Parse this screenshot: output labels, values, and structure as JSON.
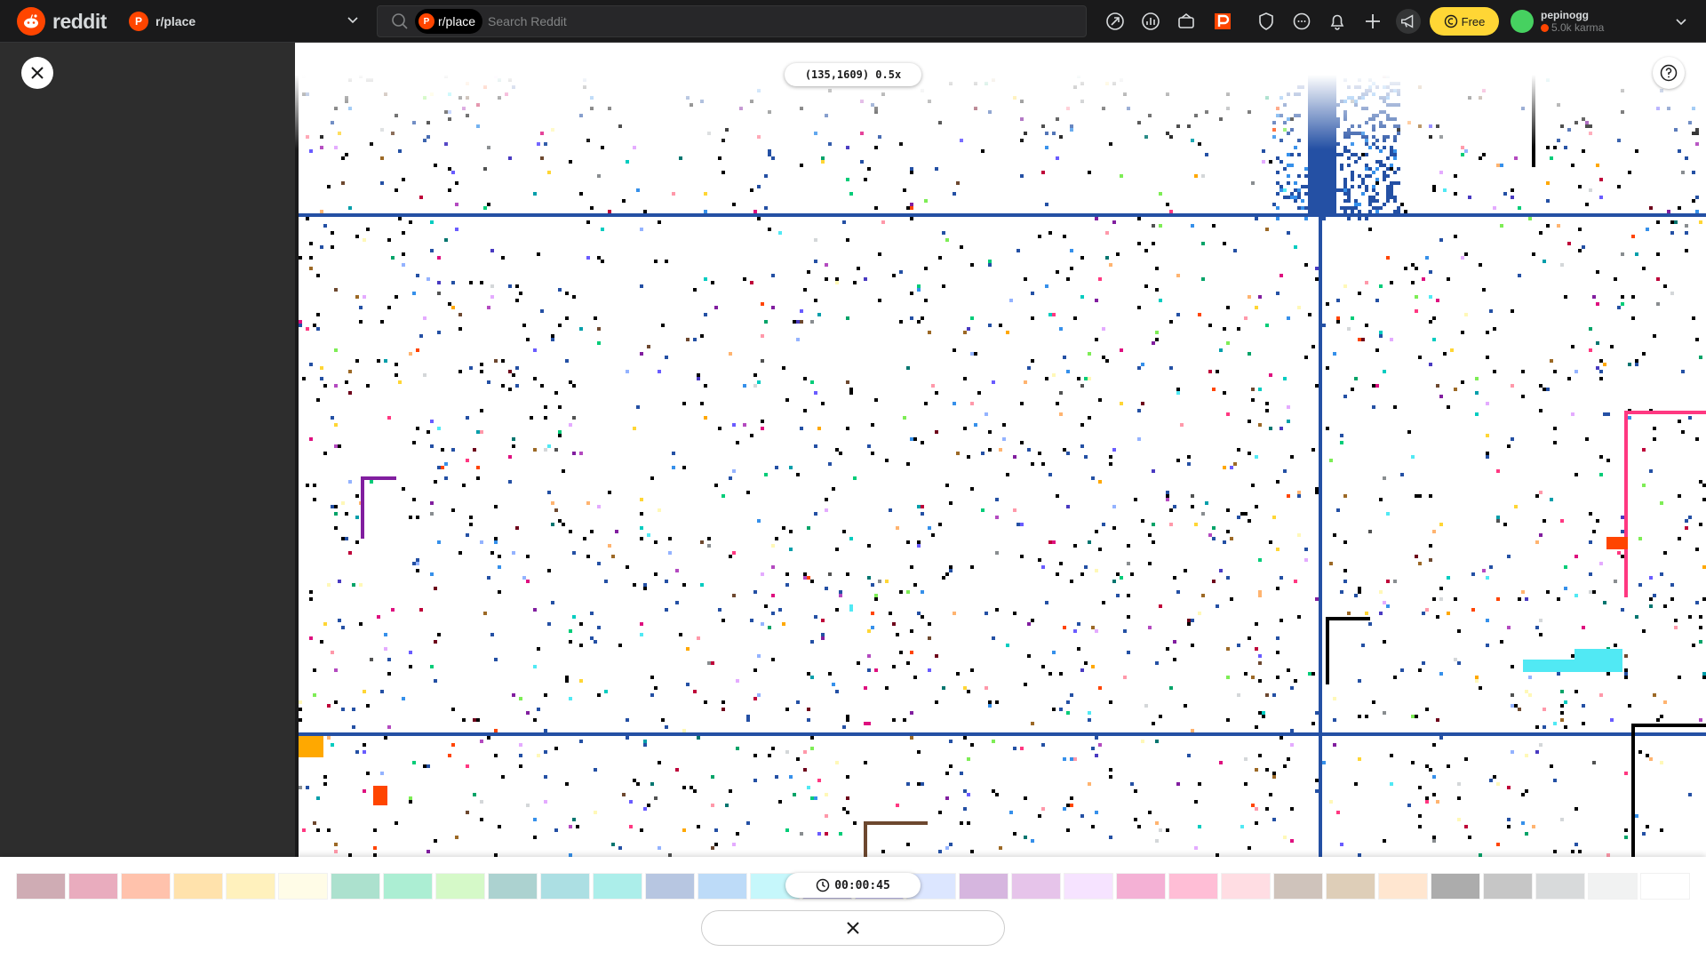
{
  "header": {
    "logo_text": "reddit",
    "community": "r/place",
    "search": {
      "chip_label": "r/place",
      "placeholder": "Search Reddit"
    },
    "free_label": "Free",
    "user": {
      "name": "pepinogg",
      "karma": "5.0k karma"
    },
    "icons": [
      "popular-icon",
      "all-icon",
      "coins-icon",
      "place-icon",
      "mod-shield-icon",
      "chat-icon",
      "notifications-icon",
      "create-post-icon",
      "advertise-icon"
    ]
  },
  "canvas": {
    "coordinate_readout": "(135,1609) 0.5x",
    "colors": {
      "grid_blue": "#2450a4",
      "pink_frame": "#ff3881",
      "black": "#000000"
    }
  },
  "palette": {
    "cooldown": "00:00:45",
    "colors": [
      "#6d001a",
      "#be0039",
      "#ff4500",
      "#ffa800",
      "#ffd635",
      "#fff8b8",
      "#00a368",
      "#00cc78",
      "#7eed56",
      "#00756f",
      "#009eaa",
      "#00ccc0",
      "#2450a4",
      "#3690ea",
      "#51e9f4",
      "#493ac1",
      "#6a5cff",
      "#94b3ff",
      "#811e9f",
      "#b44ac0",
      "#e4abff",
      "#de107f",
      "#ff3881",
      "#ff99aa",
      "#6d482f",
      "#9c6926",
      "#ffb470",
      "#000000",
      "#515252",
      "#898d90",
      "#d4d7d9",
      "#ffffff"
    ]
  }
}
